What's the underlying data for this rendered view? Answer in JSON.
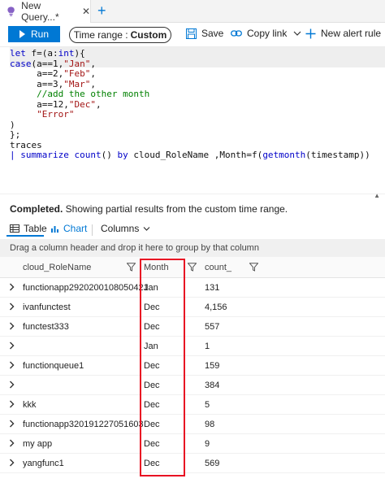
{
  "tab": {
    "label": "New Query...*",
    "close": "✕",
    "add": "+"
  },
  "toolbar": {
    "run_label": "Run",
    "time_range_label": "Time range :",
    "time_range_value": "Custom",
    "save_label": "Save",
    "copy_link_label": "Copy link",
    "new_alert_label": "New alert rule"
  },
  "editor": {
    "lines": [
      "let f=(a:int){",
      "case(a==1,\"Jan\",",
      "     a==2,\"Feb\",",
      "     a==3,\"Mar\",",
      "     //add the other month",
      "     a==12,\"Dec\",",
      "     \"Error\"",
      ")",
      "};",
      "traces",
      "| summarize count() by cloud_RoleName ,Month=f(getmonth(timestamp))"
    ]
  },
  "status": {
    "bold": "Completed.",
    "text": " Showing partial results from the custom time range."
  },
  "views": {
    "table_label": "Table",
    "chart_label": "Chart",
    "columns_label": "Columns"
  },
  "group_bar_text": "Drag a column header and drop it here to group by that column",
  "table": {
    "columns": [
      "cloud_RoleName",
      "Month",
      "count_"
    ],
    "rows": [
      [
        "functionapp2920200108050421",
        "Jan",
        "131"
      ],
      [
        "ivanfunctest",
        "Dec",
        "4,156"
      ],
      [
        "functest333",
        "Dec",
        "557"
      ],
      [
        "",
        "Jan",
        "1"
      ],
      [
        "functionqueue1",
        "Dec",
        "159"
      ],
      [
        "",
        "Dec",
        "384"
      ],
      [
        "kkk",
        "Dec",
        "5"
      ],
      [
        "functionapp320191227051603",
        "Dec",
        "98"
      ],
      [
        "my app",
        "Dec",
        "9"
      ],
      [
        "yangfunc1",
        "Dec",
        "569"
      ]
    ]
  },
  "colors": {
    "accent": "#0078d4",
    "highlight_box": "#e81123"
  },
  "icons": [
    "query-bulb-icon",
    "play-icon",
    "save-icon",
    "link-icon",
    "chevron-down-icon",
    "plus-icon",
    "table-icon",
    "chart-icon",
    "filter-icon",
    "chevron-right-icon"
  ]
}
